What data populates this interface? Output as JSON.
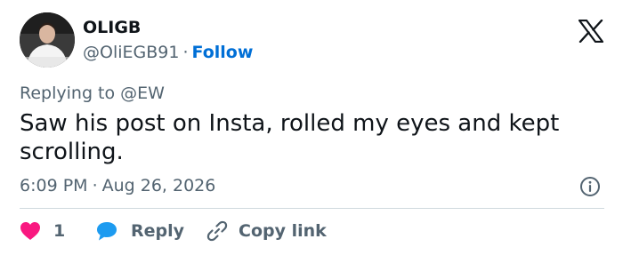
{
  "author": {
    "display_name": "OLIGB",
    "handle": "@OliEGB91",
    "separator": "·",
    "follow_label": "Follow"
  },
  "post": {
    "replying_to": "Replying to @EW",
    "text": "Saw his post on Insta, rolled my eyes and kept scrolling.",
    "time": "6:09 PM",
    "date": "Aug 26, 2026",
    "separator": "·"
  },
  "actions": {
    "like_count": "1",
    "reply_label": "Reply",
    "copy_link_label": "Copy link"
  },
  "icons": {
    "logo": "x-logo-icon",
    "info": "info-icon",
    "like": "heart-icon",
    "reply": "reply-bubble-icon",
    "copy": "link-icon"
  },
  "colors": {
    "text": "#0f1419",
    "secondary": "#536471",
    "link": "#006fd6",
    "heart": "#f91880",
    "reply_bubble": "#1d9bf0",
    "divider": "#cfd9de"
  }
}
